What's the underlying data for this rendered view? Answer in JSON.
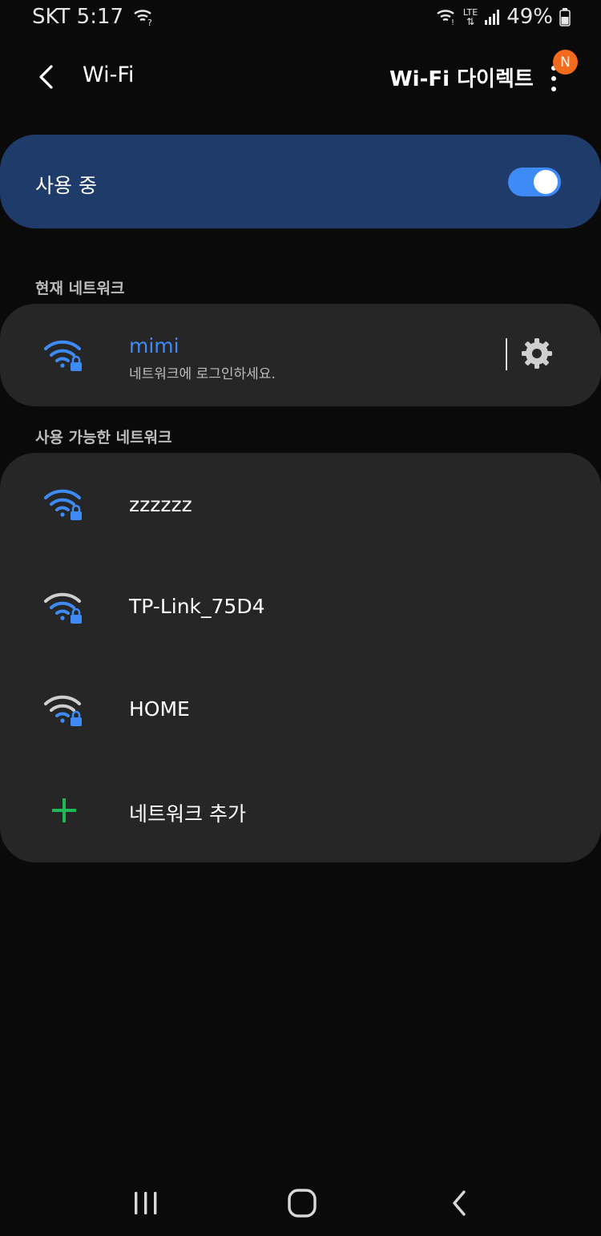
{
  "status_bar": {
    "carrier_time": "SKT 5:17",
    "network_type": "LTE",
    "battery": "49%"
  },
  "header": {
    "title": "Wi-Fi",
    "wifi_direct": "Wi-Fi 다이렉트",
    "badge": "N"
  },
  "master": {
    "label": "사용 중",
    "enabled": true
  },
  "current_section": {
    "label": "현재 네트워크",
    "network": {
      "name": "mimi",
      "status": "네트워크에 로그인하세요.",
      "icon": "wifi-lock-icon",
      "color": "#3e8af7"
    }
  },
  "available_section": {
    "label": "사용 가능한 네트워크",
    "networks": [
      {
        "name": "zzzzzz",
        "icon": "wifi-lock-icon",
        "strength": "strong"
      },
      {
        "name": "TP-Link_75D4",
        "icon": "wifi-lock-icon",
        "strength": "medium"
      },
      {
        "name": "HOME",
        "icon": "wifi-lock-icon",
        "strength": "medium"
      }
    ],
    "add_network": "네트워크 추가"
  },
  "colors": {
    "accent": "#3e8af7",
    "master_card": "#1e3b6a",
    "card": "#262626",
    "badge": "#f26a1b",
    "add": "#1db954"
  }
}
